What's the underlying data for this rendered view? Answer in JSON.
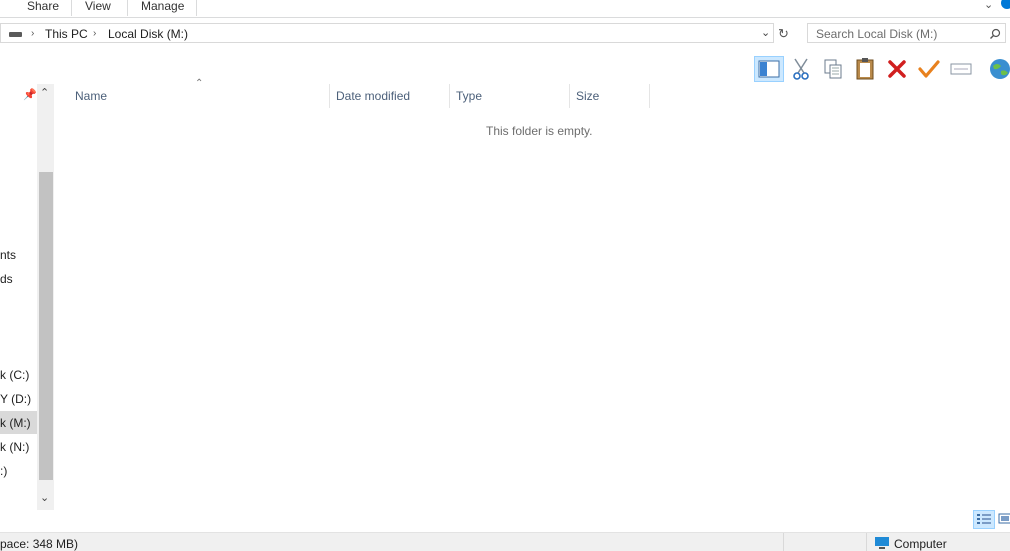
{
  "ribbon": {
    "tabs": [
      "Share",
      "View",
      "Manage"
    ]
  },
  "address": {
    "crumbs": [
      "This PC",
      "Local Disk (M:)"
    ],
    "search_placeholder": "Search Local Disk (M:)"
  },
  "columns": {
    "name": "Name",
    "date": "Date modified",
    "type": "Type",
    "size": "Size"
  },
  "empty_text": "This folder is empty.",
  "nav": {
    "items": [
      "nts",
      "ds",
      "k (C:)",
      "Y (D:)",
      "k (M:)",
      "k (N:)",
      ":)"
    ]
  },
  "status": {
    "left": "pace: 348 MB)",
    "right": "Computer"
  },
  "colors": {
    "accent": "#0078d7",
    "cut_blue": "#2a6fbf",
    "delete_red": "#d11f1f",
    "check_orange": "#e8811e",
    "selected_nav": "#cce8ff"
  }
}
